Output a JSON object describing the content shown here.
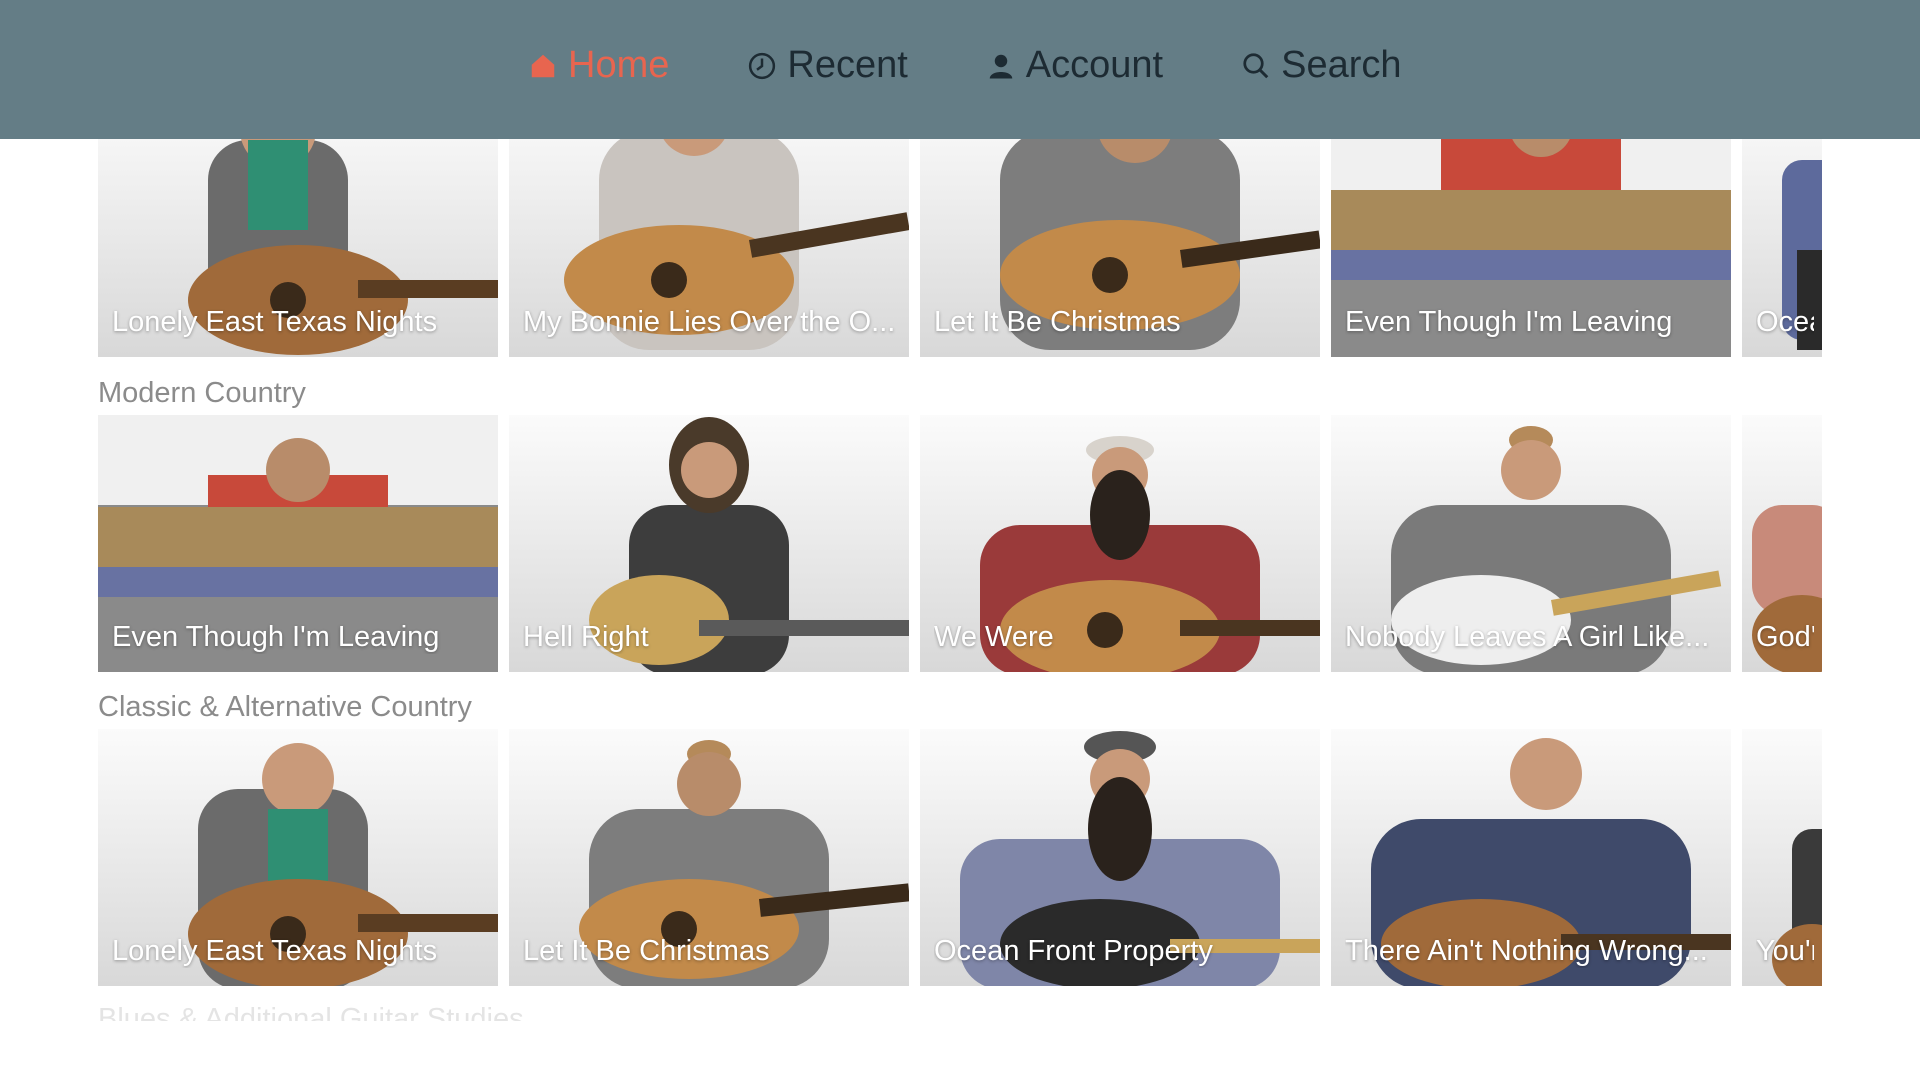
{
  "nav": {
    "items": [
      {
        "label": "Home",
        "icon": "home-icon",
        "active": true
      },
      {
        "label": "Recent",
        "icon": "clock-icon",
        "active": false
      },
      {
        "label": "Account",
        "icon": "user-icon",
        "active": false
      },
      {
        "label": "Search",
        "icon": "search-icon",
        "active": false
      }
    ]
  },
  "colors": {
    "topbar": "#647d86",
    "nav_text": "#1d2b33",
    "nav_active": "#e8654f",
    "section_title": "#8b8b8b"
  },
  "rows": [
    {
      "title": "",
      "tiles": [
        "Lonely East Texas Nights",
        "My Bonnie Lies Over the O...",
        "Let It Be Christmas",
        "Even Though I'm Leaving",
        "Ocea"
      ]
    },
    {
      "title": "Modern Country",
      "tiles": [
        "Even Though I'm Leaving",
        "Hell Right",
        "We Were",
        "Nobody Leaves A Girl Like...",
        "God's"
      ]
    },
    {
      "title": "Classic & Alternative Country",
      "tiles": [
        "Lonely East Texas Nights",
        "Let It Be Christmas",
        "Ocean Front Property",
        "There Ain't Nothing Wrong...",
        "You're"
      ]
    }
  ],
  "next_section_title": "Blues & Additional Guitar Studies"
}
